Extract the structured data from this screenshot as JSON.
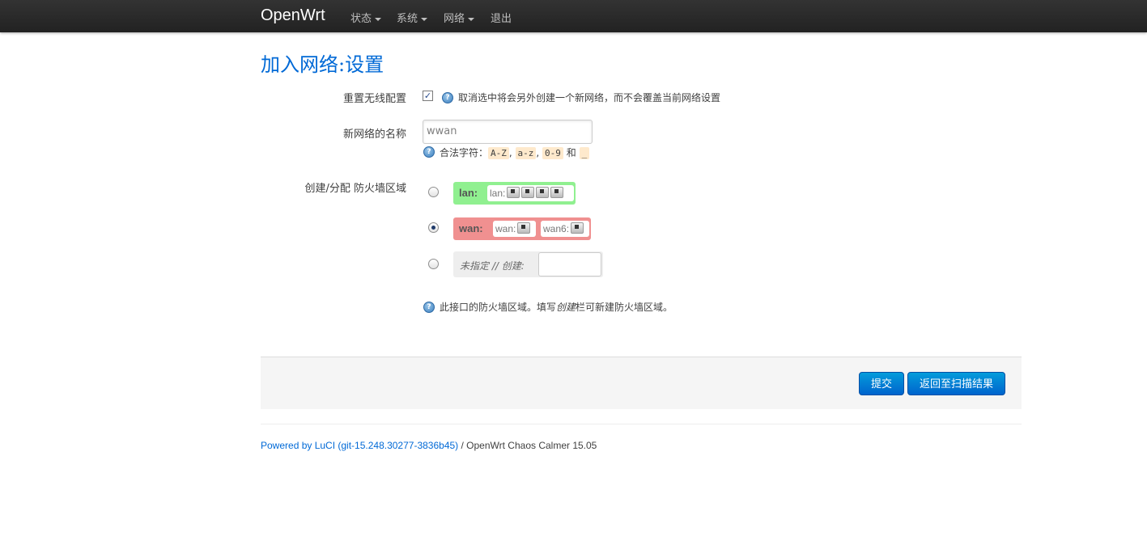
{
  "navbar": {
    "brand": "OpenWrt",
    "menu": [
      "状态",
      "系统",
      "网络",
      "退出"
    ]
  },
  "page": {
    "title": "加入网络:设置"
  },
  "form": {
    "replace_label": "重置无线配置",
    "replace_checked": true,
    "replace_help": "取消选中将会另外创建一个新网络，而不会覆盖当前网络设置",
    "name_label": "新网络的名称",
    "name_value": "wwan",
    "name_help_prefix": "合法字符：",
    "name_help_codes": [
      "A-Z",
      "a-z",
      "0-9",
      "_"
    ],
    "name_help_join": "和",
    "zone_label": "创建/分配 防火墙区域",
    "zones": [
      {
        "name": "lan:",
        "networks": [
          {
            "label": "lan:",
            "interfaces": 4
          }
        ],
        "color": "#90f090",
        "selected": false
      },
      {
        "name": "wan:",
        "networks": [
          {
            "label": "wan:",
            "interfaces": 1
          },
          {
            "label": "wan6:",
            "interfaces": 1
          }
        ],
        "color": "#f09090",
        "selected": true
      }
    ],
    "zone_new_label": "未指定 // 创建:",
    "zone_help_1": "此接口的防火墙区域。填写",
    "zone_help_em": "创建",
    "zone_help_2": "栏可新建防火墙区域。"
  },
  "actions": {
    "submit": "提交",
    "back": "返回至扫描结果"
  },
  "footer": {
    "link": "Powered by LuCI (git-15.248.30277-3836b45)",
    "text": " / OpenWrt Chaos Calmer 15.05"
  }
}
